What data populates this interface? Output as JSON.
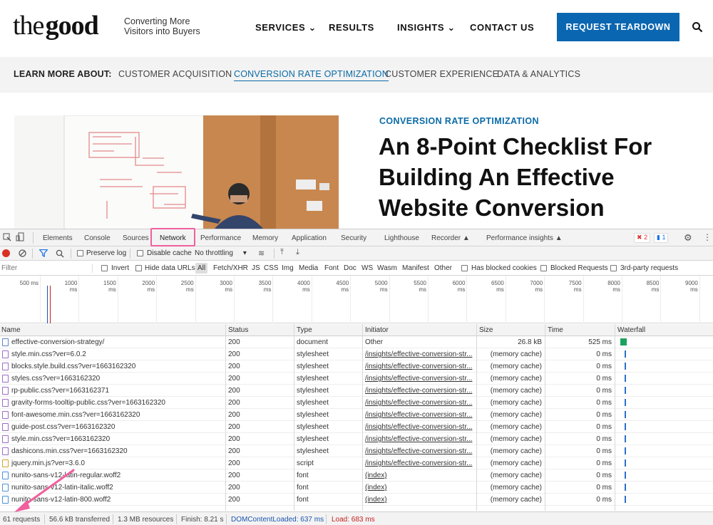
{
  "site": {
    "logo_light": "the",
    "logo_bold": "good",
    "tagline": "Converting More Visitors into Buyers",
    "nav": [
      {
        "label": "SERVICES",
        "has_dropdown": true
      },
      {
        "label": "RESULTS",
        "has_dropdown": false
      },
      {
        "label": "INSIGHTS",
        "has_dropdown": true
      },
      {
        "label": "CONTACT US",
        "has_dropdown": false
      }
    ],
    "cta_label": "REQUEST TEARDOWN",
    "learn_label": "LEARN MORE ABOUT:",
    "topics": [
      "CUSTOMER ACQUISITION",
      "CONVERSION RATE OPTIMIZATION",
      "CUSTOMER EXPERIENCE",
      "DATA & ANALYTICS"
    ],
    "active_topic": "CONVERSION RATE OPTIMIZATION",
    "article_category": "CONVERSION RATE OPTIMIZATION",
    "article_title": "An 8-Point Checklist For Building An Effective Website Conversion",
    "accent_color": "#0a66b0"
  },
  "devtools": {
    "tabs": [
      "Elements",
      "Console",
      "Sources",
      "Network",
      "Performance",
      "Memory",
      "Application",
      "Security",
      "Lighthouse",
      "Recorder",
      "Performance insights"
    ],
    "active_tab": "Network",
    "error_count": "2",
    "message_count": "1",
    "toolbar": {
      "preserve_log": "Preserve log",
      "disable_cache": "Disable cache",
      "throttling": "No throttling"
    },
    "filter": {
      "placeholder": "Filter",
      "invert": "Invert",
      "hide_data_urls": "Hide data URLs",
      "types": [
        "All",
        "Fetch/XHR",
        "JS",
        "CSS",
        "Img",
        "Media",
        "Font",
        "Doc",
        "WS",
        "Wasm",
        "Manifest",
        "Other"
      ],
      "has_blocked_cookies": "Has blocked cookies",
      "blocked_requests": "Blocked Requests",
      "third_party": "3rd-party requests"
    },
    "timeline_ticks": [
      "500 ms",
      "1000 ms",
      "1500 ms",
      "2000 ms",
      "2500 ms",
      "3000 ms",
      "3500 ms",
      "4000 ms",
      "4500 ms",
      "5000 ms",
      "5500 ms",
      "6000 ms",
      "6500 ms",
      "7000 ms",
      "7500 ms",
      "8000 ms",
      "8500 ms",
      "9000 ms"
    ],
    "columns": [
      "Name",
      "Status",
      "Type",
      "Initiator",
      "Size",
      "Time",
      "Waterfall"
    ],
    "rows": [
      {
        "name": "effective-conversion-strategy/",
        "status": "200",
        "type": "document",
        "initiator": "Other",
        "size": "26.8 kB",
        "time": "525 ms",
        "kind": "doc"
      },
      {
        "name": "style.min.css?ver=6.0.2",
        "status": "200",
        "type": "stylesheet",
        "initiator": "/insights/effective-conversion-str...",
        "size": "(memory cache)",
        "time": "0 ms",
        "kind": "css"
      },
      {
        "name": "blocks.style.build.css?ver=1663162320",
        "status": "200",
        "type": "stylesheet",
        "initiator": "/insights/effective-conversion-str...",
        "size": "(memory cache)",
        "time": "0 ms",
        "kind": "css"
      },
      {
        "name": "styles.css?ver=1663162320",
        "status": "200",
        "type": "stylesheet",
        "initiator": "/insights/effective-conversion-str...",
        "size": "(memory cache)",
        "time": "0 ms",
        "kind": "css"
      },
      {
        "name": "rp-public.css?ver=1663162371",
        "status": "200",
        "type": "stylesheet",
        "initiator": "/insights/effective-conversion-str...",
        "size": "(memory cache)",
        "time": "0 ms",
        "kind": "css"
      },
      {
        "name": "gravity-forms-tooltip-public.css?ver=1663162320",
        "status": "200",
        "type": "stylesheet",
        "initiator": "/insights/effective-conversion-str...",
        "size": "(memory cache)",
        "time": "0 ms",
        "kind": "css"
      },
      {
        "name": "font-awesome.min.css?ver=1663162320",
        "status": "200",
        "type": "stylesheet",
        "initiator": "/insights/effective-conversion-str...",
        "size": "(memory cache)",
        "time": "0 ms",
        "kind": "css"
      },
      {
        "name": "guide-post.css?ver=1663162320",
        "status": "200",
        "type": "stylesheet",
        "initiator": "/insights/effective-conversion-str...",
        "size": "(memory cache)",
        "time": "0 ms",
        "kind": "css"
      },
      {
        "name": "style.min.css?ver=1663162320",
        "status": "200",
        "type": "stylesheet",
        "initiator": "/insights/effective-conversion-str...",
        "size": "(memory cache)",
        "time": "0 ms",
        "kind": "css"
      },
      {
        "name": "dashicons.min.css?ver=1663162320",
        "status": "200",
        "type": "stylesheet",
        "initiator": "/insights/effective-conversion-str...",
        "size": "(memory cache)",
        "time": "0 ms",
        "kind": "css"
      },
      {
        "name": "jquery.min.js?ver=3.6.0",
        "status": "200",
        "type": "script",
        "initiator": "/insights/effective-conversion-str...",
        "size": "(memory cache)",
        "time": "0 ms",
        "kind": "js"
      },
      {
        "name": "nunito-sans-v12-latin-regular.woff2",
        "status": "200",
        "type": "font",
        "initiator": "(index)",
        "size": "(memory cache)",
        "time": "0 ms",
        "kind": "font"
      },
      {
        "name": "nunito-sans-v12-latin-italic.woff2",
        "status": "200",
        "type": "font",
        "initiator": "(index)",
        "size": "(memory cache)",
        "time": "0 ms",
        "kind": "font"
      },
      {
        "name": "nunito-sans-v12-latin-800.woff2",
        "status": "200",
        "type": "font",
        "initiator": "(index)",
        "size": "(memory cache)",
        "time": "0 ms",
        "kind": "font"
      }
    ],
    "summary": {
      "requests": "61 requests",
      "transferred": "56.6 kB transferred",
      "resources": "1.3 MB resources",
      "finish": "Finish: 8.21 s",
      "dom_content_loaded": "DOMContentLoaded: 637 ms",
      "load": "Load: 683 ms"
    },
    "highlight_color": "#f0609e"
  }
}
